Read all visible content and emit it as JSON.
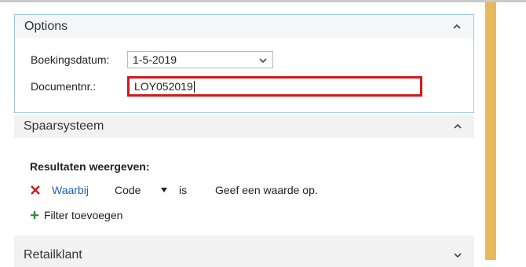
{
  "options": {
    "title": "Options",
    "booking_date_label": "Boekingsdatum:",
    "booking_date_value": "1-5-2019",
    "document_label": "Documentnr.:",
    "document_value": "LOY052019"
  },
  "spaarsysteem": {
    "title": "Spaarsysteem",
    "filter_heading": "Resultaten weergeven:",
    "filter": {
      "field_label": "Waarbij",
      "field_name": "Code",
      "operator": "is",
      "value_placeholder": "Geef een waarde op."
    },
    "add_filter_label": "Filter toevoegen"
  },
  "retailklant": {
    "title": "Retailklant"
  },
  "colors": {
    "accent_blue": "#1f5fb4",
    "highlight_red": "#d0191c",
    "side_strip": "#e8b85a"
  }
}
